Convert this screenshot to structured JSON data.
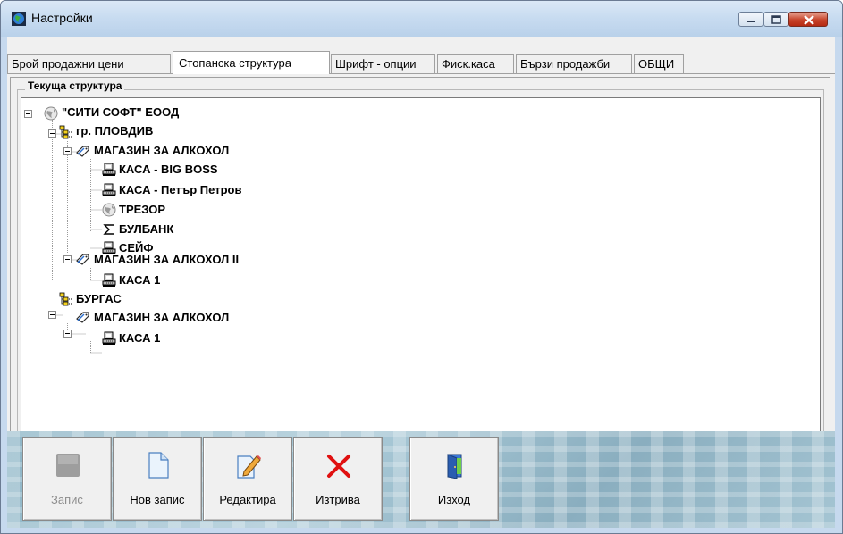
{
  "window": {
    "title": "Настройки"
  },
  "tabs": [
    {
      "label": "Брой продажни цени",
      "active": false
    },
    {
      "label": "Стопанска структура",
      "active": true
    },
    {
      "label": "Шрифт - опции",
      "active": false
    },
    {
      "label": "Фиск.каса",
      "active": false
    },
    {
      "label": "Бързи продажби",
      "active": false
    },
    {
      "label": "ОБЩИ",
      "active": false
    }
  ],
  "structure": {
    "group_label": "Текуща структура",
    "nodes": [
      {
        "label": "\"СИТИ СОФТ\" ЕООД",
        "icon": "globe-icon",
        "expanded": true
      },
      {
        "label": "гр. ПЛОВДИВ",
        "icon": "org-tree-icon",
        "expanded": true
      },
      {
        "label": "МАГАЗИН ЗА АЛКОХОЛ",
        "icon": "tag-icon",
        "expanded": true
      },
      {
        "label": "КАСА - BIG BOSS",
        "icon": "cash-register-icon"
      },
      {
        "label": "КАСА - Петър Петров",
        "icon": "cash-register-icon"
      },
      {
        "label": "ТРЕЗОР",
        "icon": "globe-icon"
      },
      {
        "label": "БУЛБАНК",
        "icon": "sigma-icon"
      },
      {
        "label": "СЕЙФ",
        "icon": "cash-register-icon"
      },
      {
        "label": "МАГАЗИН ЗА АЛКОХОЛ II",
        "icon": "tag-icon",
        "expanded": true
      },
      {
        "label": "КАСА 1",
        "icon": "cash-register-icon"
      },
      {
        "label": "БУРГАС",
        "icon": "org-tree-icon",
        "expanded": true
      },
      {
        "label": "МАГАЗИН ЗА АЛКОХОЛ",
        "icon": "tag-icon",
        "expanded": true
      },
      {
        "label": "КАСА 1",
        "icon": "cash-register-icon"
      }
    ]
  },
  "toolbar": {
    "save_label": "Запис",
    "new_label": "Нов запис",
    "edit_label": "Редактира",
    "delete_label": "Изтрива",
    "exit_label": "Изход"
  },
  "colors": {
    "accent": "#3b78d8",
    "delete_red": "#e01010"
  }
}
